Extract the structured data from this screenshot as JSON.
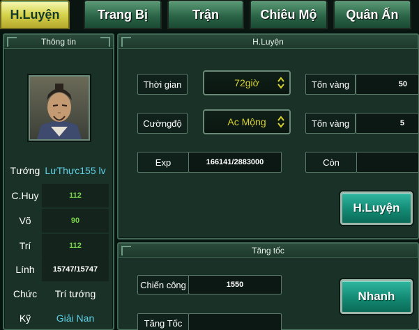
{
  "tabs": [
    {
      "label": "H.Luyện",
      "active": true
    },
    {
      "label": "Trang Bị",
      "active": false
    },
    {
      "label": "Trận",
      "active": false
    },
    {
      "label": "Chiêu Mộ",
      "active": false
    },
    {
      "label": "Quân Ấn",
      "active": false
    }
  ],
  "info_panel": {
    "title": "Thông tin",
    "stats": [
      {
        "label": "Tướng",
        "value": "LưThực155 lv"
      },
      {
        "label": "C.Huy",
        "value": "112"
      },
      {
        "label": "Võ",
        "value": "90"
      },
      {
        "label": "Trí",
        "value": "112"
      },
      {
        "label": "Lính",
        "value": "15747/15747"
      },
      {
        "label": "Chức",
        "value": "Trí tướng"
      },
      {
        "label": "Kỹ",
        "value": "Giải Nan"
      }
    ]
  },
  "training_panel": {
    "title": "H.Luyện",
    "time_label": "Thời gian",
    "time_value": "72giờ",
    "intensity_label": "Cườngđộ",
    "intensity_value": "Ac Mộng",
    "cost1_label": "Tốn vàng",
    "cost1_value": "50",
    "cost2_label": "Tốn vàng",
    "cost2_value": "5",
    "exp_label": "Exp",
    "exp_value": "166141/2883000",
    "remain_label": "Còn",
    "remain_value": "",
    "train_button": "H.Luyện"
  },
  "speed_panel": {
    "title": "Tăng tốc",
    "merit_label": "Chiến công",
    "merit_value": "1550",
    "speedup_label": "Tăng Tốc",
    "speedup_value": "",
    "fast_button": "Nhanh"
  },
  "colors": {
    "active_tab": "#d6d34c",
    "tab": "#2c6548",
    "panel": "#1a3128",
    "button": "#138a74",
    "select_text": "#d9d330",
    "stat_green": "#79d24a",
    "stat_cyan": "#5ed0e6"
  }
}
